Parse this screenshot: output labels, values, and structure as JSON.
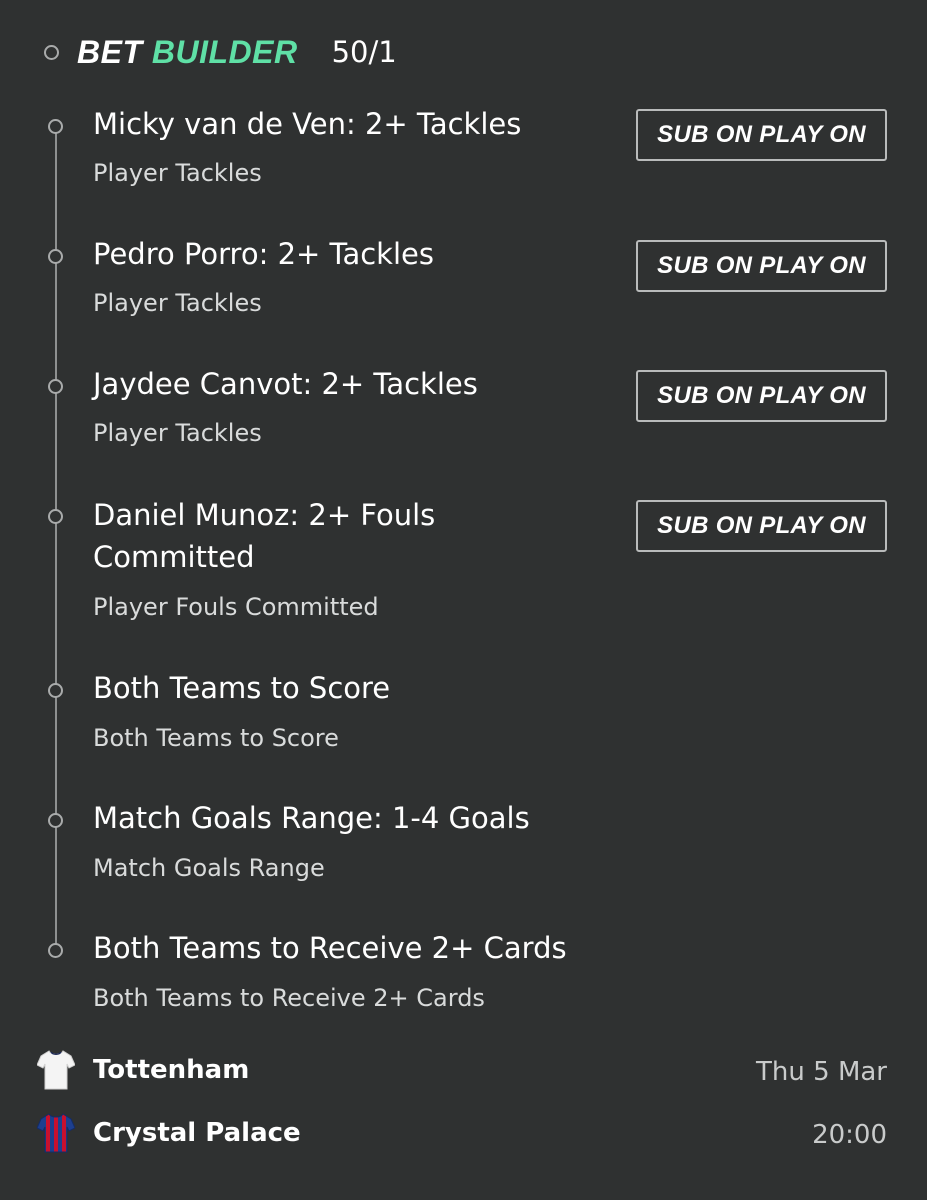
{
  "header": {
    "bet_word": "BET",
    "builder_word": "BUILDER",
    "odds": "50/1",
    "accent_color": "#5fe0a6"
  },
  "legs": [
    {
      "title": "Micky van de Ven: 2+ Tackles",
      "subtitle": "Player Tackles",
      "button": "SUB ON PLAY ON"
    },
    {
      "title": "Pedro Porro: 2+ Tackles",
      "subtitle": "Player Tackles",
      "button": "SUB ON PLAY ON"
    },
    {
      "title": "Jaydee Canvot: 2+ Tackles",
      "subtitle": "Player Tackles",
      "button": "SUB ON PLAY ON"
    },
    {
      "title": "Daniel Munoz: 2+ Fouls Committed",
      "subtitle": "Player Fouls Committed",
      "button": "SUB ON PLAY ON"
    },
    {
      "title": "Both Teams to Score",
      "subtitle": "Both Teams to Score"
    },
    {
      "title": "Match Goals Range: 1-4 Goals",
      "subtitle": "Match Goals Range"
    },
    {
      "title": "Both Teams to Receive 2+ Cards",
      "subtitle": "Both Teams to Receive 2+ Cards"
    }
  ],
  "match": {
    "home": {
      "name": "Tottenham",
      "kit_icon": "white-shirt-icon"
    },
    "away": {
      "name": "Crystal Palace",
      "kit_icon": "striped-shirt-icon"
    },
    "date": "Thu 5 Mar",
    "time": "20:00"
  }
}
